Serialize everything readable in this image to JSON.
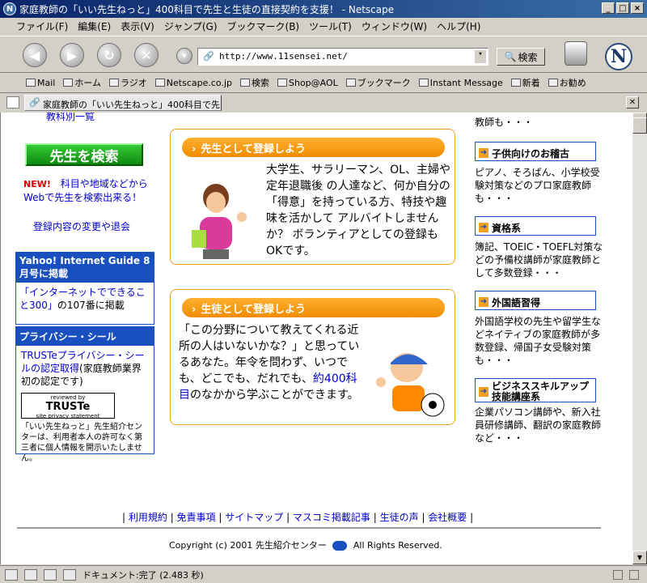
{
  "window": {
    "title": "家庭教師の「いい先生ねっと」400科目で先生と生徒の直接契約を支援！ - Netscape"
  },
  "menu": [
    "ファイル(F)",
    "編集(E)",
    "表示(V)",
    "ジャンプ(G)",
    "ブックマーク(B)",
    "ツール(T)",
    "ウィンドウ(W)",
    "ヘルプ(H)"
  ],
  "navbar": {
    "url": "http://www.11sensei.net/",
    "search_label": "検索"
  },
  "personal_toolbar": [
    "Mail",
    "ホーム",
    "ラジオ",
    "Netscape.co.jp",
    "検索",
    "Shop@AOL",
    "ブックマーク",
    "Instant Message",
    "新着",
    "お勧め"
  ],
  "tab": {
    "label": "家庭教師の「いい先生ねっと」400科目で先..."
  },
  "left": {
    "top_cut_link": "教科別一覧",
    "search_button": "先生を検索",
    "new_badge": "NEW!",
    "new_text": "科目や地域などから",
    "new_text2": "Webで先生を検索出来る！",
    "change_link": "登録内容の変更や退会",
    "yahoo_head": "Yahoo! Internet Guide 8月号に掲載",
    "yahoo_link": "「インターネットでできること300」",
    "yahoo_suffix": "の107番に掲載",
    "privacy_head": "プライバシー・シール",
    "truste_link": "TRUSTeプライバシー・シールの認定取得",
    "truste_suffix": "(家庭教師業界初の認定です)",
    "truste_logo_small": "reviewed by",
    "truste_logo": "TRUSTe",
    "truste_logo_sub": "site privacy statement",
    "privacy_note": "「いい先生ねっと」先生紹介センターは、利用者本人の許可なく第三者に個人情報を開示いたしません。"
  },
  "center": {
    "teacher_bar": "先生として登録しよう",
    "teacher_text": "大学生、サラリーマン、OL、主婦や定年退職後 の人達など、何か自分の「得意」を持っている方、特技や趣味を活かして アルバイトしませんか？ ボランティアとしての登録もOKです。",
    "student_bar": "生徒として登録しよう",
    "student_text_a": "「この分野について教えてくれる近所の人はいないかな？」と思っているあなた。年令を問わず、いつでも、どこでも、だれでも、",
    "student_link": "約400科目",
    "student_text_b": "のなかから学ぶことができます。"
  },
  "right": {
    "top_cut": "教師も・・・",
    "items": [
      {
        "head": "子供向けのお稽古",
        "text": "ピアノ、そろばん、小学校受験対策などのプロ家庭教師も・・・"
      },
      {
        "head": "資格系",
        "text": "簿記、TOEIC・TOEFL対策などの予備校講師が家庭教師として多数登録・・・"
      },
      {
        "head": "外国語習得",
        "text": "外国語学校の先生や留学生などネイティブの家庭教師が多数登録、帰国子女受験対策も・・・"
      },
      {
        "head": "ビジネススキルアップ技能講座系",
        "text": "企業パソコン講師や、新入社員研修講師、翻訳の家庭教師など・・・"
      }
    ]
  },
  "footer": {
    "links": [
      "利用規約",
      "免責事項",
      "サイトマップ",
      "マスコミ掲載記事",
      "生徒の声",
      "会社概要"
    ],
    "copyright": "Copyright (c) 2001 先生紹介センター",
    "rights": "All Rights Reserved."
  },
  "status": {
    "text": "ドキュメント:完了 (2.483 秒)"
  },
  "colors": {
    "accent_blue": "#1a4fbf",
    "accent_orange": "#f08c00",
    "green_button": "#22aa22"
  }
}
